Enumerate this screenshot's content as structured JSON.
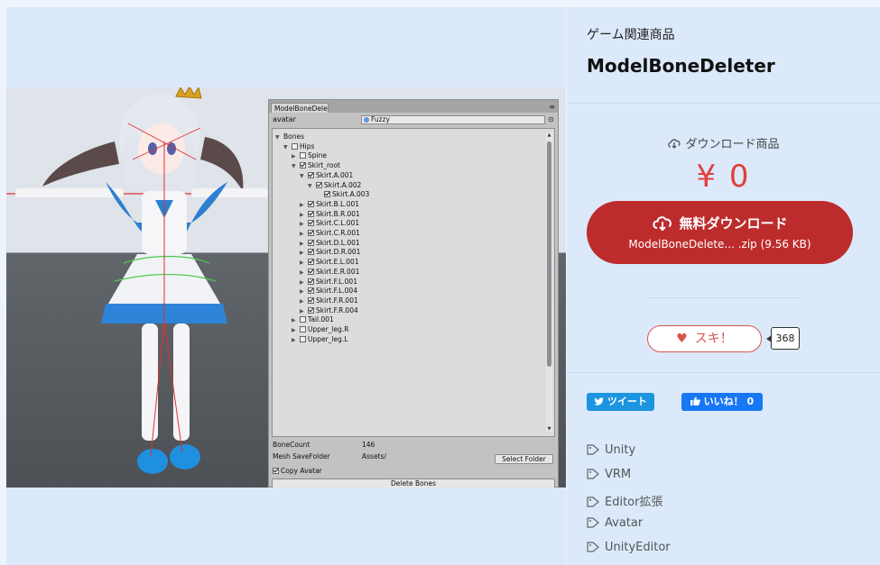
{
  "editor": {
    "tab_title": "ModelBoneDele",
    "menu_glyph": "≡",
    "avatar_label": "avatar",
    "avatar_value": "Fuzzy",
    "settings_glyph": "⊙",
    "tree": [
      {
        "label": "Bones",
        "arrow": "▼",
        "checkbox": "none",
        "depth": 0
      },
      {
        "label": "Hips",
        "arrow": "▼",
        "checkbox": "off",
        "depth": 1
      },
      {
        "label": "Spine",
        "arrow": "▶",
        "checkbox": "off",
        "depth": 2
      },
      {
        "label": "Skirt_root",
        "arrow": "▼",
        "checkbox": "on",
        "depth": 2
      },
      {
        "label": "Skirt.A.001",
        "arrow": "▼",
        "checkbox": "on",
        "depth": 3
      },
      {
        "label": "Skirt.A.002",
        "arrow": "▼",
        "checkbox": "on",
        "depth": 4
      },
      {
        "label": "Skirt.A.003",
        "arrow": "",
        "checkbox": "on",
        "depth": 5
      },
      {
        "label": "Skirt.B.L.001",
        "arrow": "▶",
        "checkbox": "on",
        "depth": 3
      },
      {
        "label": "Skirt.B.R.001",
        "arrow": "▶",
        "checkbox": "on",
        "depth": 3
      },
      {
        "label": "Skirt.C.L.001",
        "arrow": "▶",
        "checkbox": "on",
        "depth": 3
      },
      {
        "label": "Skirt.C.R.001",
        "arrow": "▶",
        "checkbox": "on",
        "depth": 3
      },
      {
        "label": "Skirt.D.L.001",
        "arrow": "▶",
        "checkbox": "on",
        "depth": 3
      },
      {
        "label": "Skirt.D.R.001",
        "arrow": "▶",
        "checkbox": "on",
        "depth": 3
      },
      {
        "label": "Skirt.E.L.001",
        "arrow": "▶",
        "checkbox": "on",
        "depth": 3
      },
      {
        "label": "Skirt.E.R.001",
        "arrow": "▶",
        "checkbox": "on",
        "depth": 3
      },
      {
        "label": "Skirt.F.L.001",
        "arrow": "▶",
        "checkbox": "on",
        "depth": 3
      },
      {
        "label": "Skirt.F.L.004",
        "arrow": "▶",
        "checkbox": "on",
        "depth": 3
      },
      {
        "label": "Skirt.F.R.001",
        "arrow": "▶",
        "checkbox": "on",
        "depth": 3
      },
      {
        "label": "Skirt.F.R.004",
        "arrow": "▶",
        "checkbox": "on",
        "depth": 3
      },
      {
        "label": "Tail.001",
        "arrow": "▶",
        "checkbox": "off",
        "depth": 2
      },
      {
        "label": "Upper_leg.R",
        "arrow": "▶",
        "checkbox": "off",
        "depth": 2
      },
      {
        "label": "Upper_leg.L",
        "arrow": "▶",
        "checkbox": "off",
        "depth": 2
      }
    ],
    "bone_count_label": "BoneCount",
    "bone_count_value": "146",
    "mesh_folder_label": "Mesh SaveFolder",
    "mesh_folder_value": "Assets/",
    "select_folder_label": "Select Folder",
    "copy_avatar_label": "Copy Avatar",
    "copy_avatar_checked": true,
    "delete_bones_label": "Delete Bones"
  },
  "product": {
    "category": "ゲーム関連商品",
    "title": "ModelBoneDeleter",
    "download_type": "ダウンロード商品",
    "price": "¥ 0",
    "download_button_label": "無料ダウンロード",
    "download_file": "ModelBoneDelete... .zip (9.56 KB)",
    "like_label": "スキ！",
    "like_count": "368",
    "tweet_label": "ツイート",
    "fb_label": "いいね！ 0",
    "tags": [
      "Unity",
      "VRM",
      "Editor拡張",
      "Avatar",
      "UnityEditor"
    ]
  },
  "colors": {
    "panel_bg": "#dbe9fb",
    "download_button": "#bd2c2c",
    "price": "#e0403a",
    "tweet": "#1b95e0",
    "facebook": "#1877f2"
  },
  "icons": {
    "download_type": "cloud-download-icon",
    "download_button": "cloud-download-icon",
    "like": "heart-icon",
    "tweet": "twitter-bird-icon",
    "fb": "thumbs-up-icon",
    "tag": "tag-icon"
  }
}
